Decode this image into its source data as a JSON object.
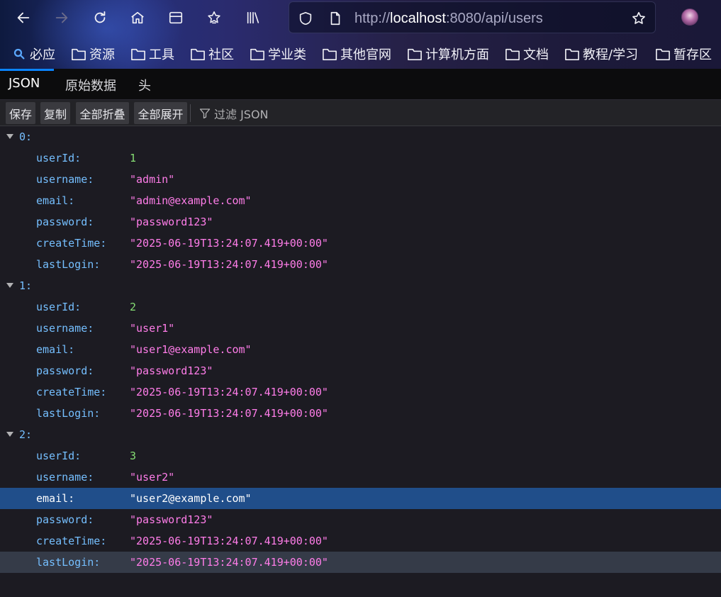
{
  "browser": {
    "url_scheme": "http://",
    "url_host": "localhost",
    "url_path": ":8080/api/users"
  },
  "bookmarks": [
    "必应",
    "资源",
    "工具",
    "社区",
    "学业类",
    "其他官网",
    "计算机方面",
    "文档",
    "教程/学习",
    "暂存区"
  ],
  "viewer": {
    "tabs": [
      "JSON",
      "原始数据",
      "头"
    ],
    "active_tab": "JSON",
    "toolbar": {
      "save": "保存",
      "copy": "复制",
      "collapse_all": "全部折叠",
      "expand_all": "全部展开",
      "filter_placeholder": "过滤 JSON"
    }
  },
  "json_tree": [
    {
      "index": "0:",
      "fields": [
        {
          "key": "userId:",
          "value": "1",
          "type": "number"
        },
        {
          "key": "username:",
          "value": "\"admin\"",
          "type": "string"
        },
        {
          "key": "email:",
          "value": "\"admin@example.com\"",
          "type": "string"
        },
        {
          "key": "password:",
          "value": "\"password123\"",
          "type": "string"
        },
        {
          "key": "createTime:",
          "value": "\"2025-06-19T13:24:07.419+00:00\"",
          "type": "string"
        },
        {
          "key": "lastLogin:",
          "value": "\"2025-06-19T13:24:07.419+00:00\"",
          "type": "string"
        }
      ]
    },
    {
      "index": "1:",
      "fields": [
        {
          "key": "userId:",
          "value": "2",
          "type": "number"
        },
        {
          "key": "username:",
          "value": "\"user1\"",
          "type": "string"
        },
        {
          "key": "email:",
          "value": "\"user1@example.com\"",
          "type": "string"
        },
        {
          "key": "password:",
          "value": "\"password123\"",
          "type": "string"
        },
        {
          "key": "createTime:",
          "value": "\"2025-06-19T13:24:07.419+00:00\"",
          "type": "string"
        },
        {
          "key": "lastLogin:",
          "value": "\"2025-06-19T13:24:07.419+00:00\"",
          "type": "string"
        }
      ]
    },
    {
      "index": "2:",
      "fields": [
        {
          "key": "userId:",
          "value": "3",
          "type": "number"
        },
        {
          "key": "username:",
          "value": "\"user2\"",
          "type": "string"
        },
        {
          "key": "email:",
          "value": "\"user2@example.com\"",
          "type": "string"
        },
        {
          "key": "password:",
          "value": "\"password123\"",
          "type": "string"
        },
        {
          "key": "createTime:",
          "value": "\"2025-06-19T13:24:07.419+00:00\"",
          "type": "string"
        },
        {
          "key": "lastLogin:",
          "value": "\"2025-06-19T13:24:07.419+00:00\"",
          "type": "string"
        }
      ]
    }
  ],
  "colors": {
    "key": "#75bfff",
    "number": "#86de74",
    "string": "#ff7de9",
    "selected_row": "#204e8a",
    "hover_row": "#353b48",
    "accent": "#0a84ff"
  }
}
